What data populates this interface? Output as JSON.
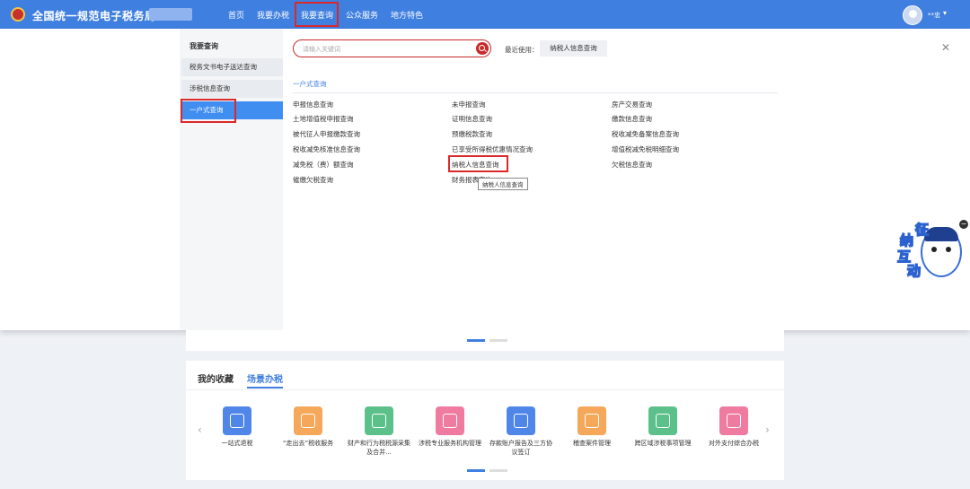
{
  "header": {
    "brand": "全国统一规范电子税务局",
    "nav": [
      "首页",
      "我要办税",
      "我要查询",
      "公众服务",
      "地方特色"
    ],
    "user_name": "**忠"
  },
  "menu": {
    "sidebar_title": "我要查询",
    "sidebar_items": [
      "税务文书电子送达查询",
      "涉税信息查询",
      "一户式查询"
    ],
    "search_placeholder": "请输入关键词",
    "recent_label": "最近使用：",
    "recent_chip": "纳税人信息查询",
    "section_title": "一户式查询",
    "links_col1": [
      "申报信息查询",
      "土地增值税申报查询",
      "被代征人申报缴款查询",
      "税收减免核准信息查询",
      "减免税（费）额查询",
      "催缴欠税查询"
    ],
    "links_col2": [
      "未申报查询",
      "证明信息查询",
      "预缴税款查询",
      "已享受所得税优惠情况查询",
      "纳税人信息查询",
      "财务报表查询"
    ],
    "links_col3": [
      "房产交易查询",
      "缴款信息查询",
      "税收减免备案信息查询",
      "增值税减免税明细查询",
      "欠税信息查询"
    ],
    "tooltip": "纳税人信息查询"
  },
  "mascot": {
    "chars": [
      "征",
      "纳",
      "互",
      "动"
    ]
  },
  "collection": {
    "tabs": [
      "我的收藏",
      "场景办税"
    ],
    "services": [
      {
        "label": "一站式退税",
        "color": "#4f86e8"
      },
      {
        "label": "“走出去”税收服务",
        "color": "#f6a85a"
      },
      {
        "label": "财产和行为税税源采集及合并...",
        "color": "#5bc08a"
      },
      {
        "label": "涉税专业服务机构管理",
        "color": "#f07ba0"
      },
      {
        "label": "存款账户报告及三方协议签订",
        "color": "#4f86e8"
      },
      {
        "label": "稽查案件管理",
        "color": "#f6a85a"
      },
      {
        "label": "跨区域涉税事项管理",
        "color": "#5bc08a"
      },
      {
        "label": "对外支付综合办税",
        "color": "#f07ba0"
      }
    ]
  }
}
